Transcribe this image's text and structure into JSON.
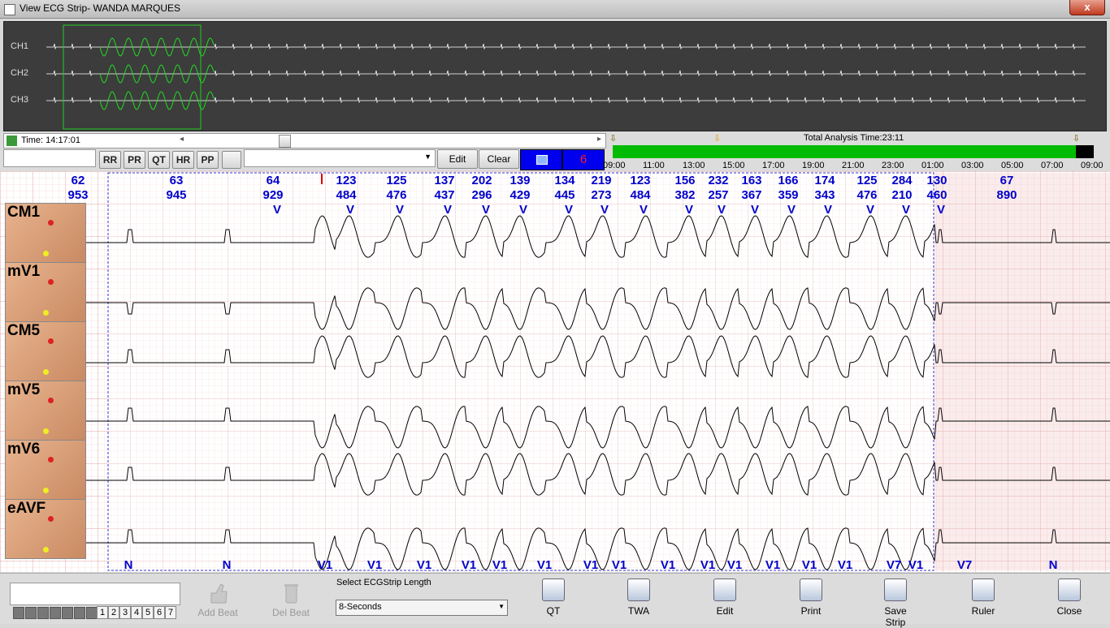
{
  "window": {
    "title": "View ECG Strip- WANDA MARQUES",
    "close_glyph": "x"
  },
  "overview": {
    "channels": [
      "CH1",
      "CH2",
      "CH3"
    ]
  },
  "toolbar": {
    "time_label": "Time: 14:17:01",
    "measure_buttons": [
      "RR",
      "PR",
      "QT",
      "HR",
      "PP"
    ],
    "edit_label": "Edit",
    "clear_label": "Clear",
    "event_count": "6",
    "total_analysis": "Total Analysis Time:23:11",
    "time_ticks": [
      "09:00",
      "11:00",
      "13:00",
      "15:00",
      "17:00",
      "19:00",
      "21:00",
      "23:00",
      "01:00",
      "03:00",
      "05:00",
      "07:00",
      "09:00"
    ]
  },
  "strip": {
    "leads": [
      "CM1",
      "mV1",
      "CM5",
      "mV5",
      "mV6",
      "eAVF"
    ],
    "hr_values": [
      "62",
      "63",
      "64",
      "123",
      "125",
      "137",
      "202",
      "139",
      "134",
      "219",
      "123",
      "156",
      "232",
      "163",
      "166",
      "174",
      "125",
      "284",
      "130",
      "67"
    ],
    "rr_values": [
      "953",
      "945",
      "929",
      "484",
      "476",
      "437",
      "296",
      "429",
      "445",
      "273",
      "484",
      "382",
      "257",
      "367",
      "359",
      "343",
      "476",
      "210",
      "460",
      "890"
    ],
    "top_beat_labels": [
      "V",
      "V",
      "V",
      "V",
      "V",
      "V",
      "V",
      "V",
      "V",
      "V",
      "V",
      "V",
      "V",
      "V",
      "V",
      "V",
      "V",
      "V"
    ],
    "bottom_beat_labels": [
      "N",
      "N",
      "V1",
      "V1",
      "V1",
      "V1",
      "V1",
      "V1",
      "V1",
      "V1",
      "V1",
      "V1",
      "V1",
      "V1",
      "V1",
      "V1",
      "V7",
      "V1",
      "V7",
      "N"
    ]
  },
  "bottom": {
    "page_numbers": [
      "1",
      "2",
      "3",
      "4",
      "5",
      "6",
      "7"
    ],
    "add_beat": "Add Beat",
    "del_beat": "Del Beat",
    "strip_length_label": "Select ECGStrip Length",
    "strip_length_value": "8-Seconds",
    "tools": [
      "QT",
      "TWA",
      "Edit",
      "Print",
      "Save Strip",
      "Ruler",
      "Close"
    ]
  },
  "colors": {
    "grid_minor": "#f2c6c6",
    "grid_major": "#e08f8f",
    "label_blue": "#0000cc",
    "overview_trace": "#ffffff",
    "overview_highlight": "#22dd22",
    "progress": "#00bb00"
  }
}
